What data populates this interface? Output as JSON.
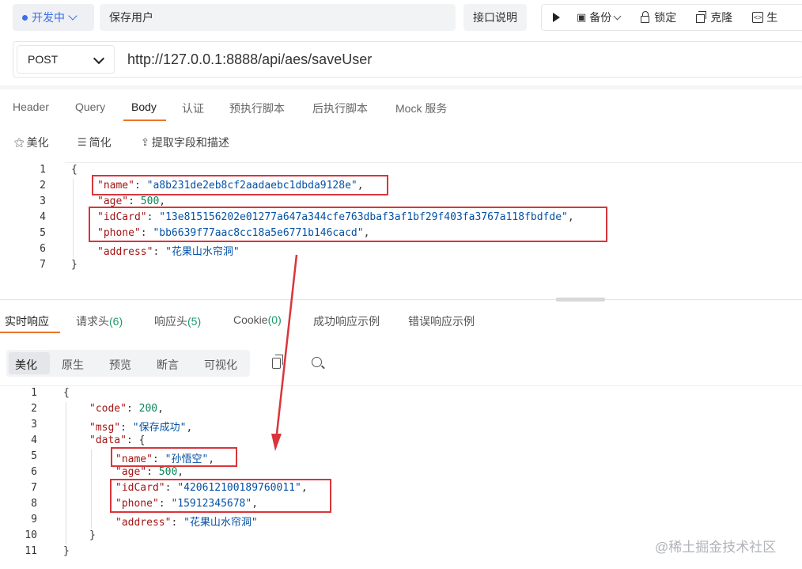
{
  "topbar": {
    "env_label": "开发中",
    "api_name": "保存用户",
    "doc_button": "接口说明",
    "toolbar": {
      "backup": "备份",
      "lock": "锁定",
      "clone": "克隆",
      "generate_code": "生"
    }
  },
  "request": {
    "method": "POST",
    "url": "http://127.0.0.1:8888/api/aes/saveUser",
    "tabs": [
      "Header",
      "Query",
      "Body",
      "认证",
      "预执行脚本",
      "后执行脚本",
      "Mock 服务"
    ],
    "active_tab": "Body",
    "body_tools": {
      "beautify": "美化",
      "simplify": "简化",
      "extract": "提取字段和描述"
    },
    "body_lines": {
      "n1": "1",
      "n2": "2",
      "n3": "3",
      "n4": "4",
      "n5": "5",
      "n6": "6",
      "n7": "7",
      "l1": "{",
      "l2_key": "\"name\"",
      "l2_val": "\"a8b231de2eb8cf2aadaebc1dbda9128e\"",
      "l3_key": "\"age\"",
      "l3_val": "500",
      "l4_key": "\"idCard\"",
      "l4_val": "\"13e815156202e01277a647a344cfe763dbaf3af1bf29f403fa3767a118fbdfde\"",
      "l5_key": "\"phone\"",
      "l5_val": "\"bb6639f77aac8cc18a5e6771b146cacd\"",
      "l6_key": "\"address\"",
      "l6_val": "\"花果山水帘洞\"",
      "l7": "}"
    }
  },
  "response": {
    "tabs": {
      "realtime": "实时响应",
      "req_headers": "请求头",
      "req_headers_count": "6",
      "resp_headers": "响应头",
      "resp_headers_count": "5",
      "cookie": "Cookie",
      "cookie_count": "0",
      "success_example": "成功响应示例",
      "error_example": "错误响应示例"
    },
    "view_tabs": [
      "美化",
      "原生",
      "预览",
      "断言",
      "可视化"
    ],
    "body_lines": {
      "n1": "1",
      "n2": "2",
      "n3": "3",
      "n4": "4",
      "n5": "5",
      "n6": "6",
      "n7": "7",
      "n8": "8",
      "n9": "9",
      "n10": "10",
      "n11": "11",
      "l1": "{",
      "l2_key": "\"code\"",
      "l2_val": "200",
      "l3_key": "\"msg\"",
      "l3_val": "\"保存成功\"",
      "l4_key": "\"data\"",
      "l4_val": "{",
      "l5_key": "\"name\"",
      "l5_val": "\"孙悟空\"",
      "l6_key": "\"age\"",
      "l6_val": "500",
      "l7_key": "\"idCard\"",
      "l7_val": "\"420612100189760011\"",
      "l8_key": "\"phone\"",
      "l8_val": "\"15912345678\"",
      "l9_key": "\"address\"",
      "l9_val": "\"花果山水帘洞\"",
      "l10": "}",
      "l11": "}"
    }
  },
  "watermark": "@稀土掘金技术社区",
  "colors": {
    "accent": "#e8762d",
    "env_blue": "#3b6ee8",
    "json_key": "#a31515",
    "json_string": "#0451a5",
    "json_number": "#098658",
    "highlight_red": "#d9353b"
  }
}
